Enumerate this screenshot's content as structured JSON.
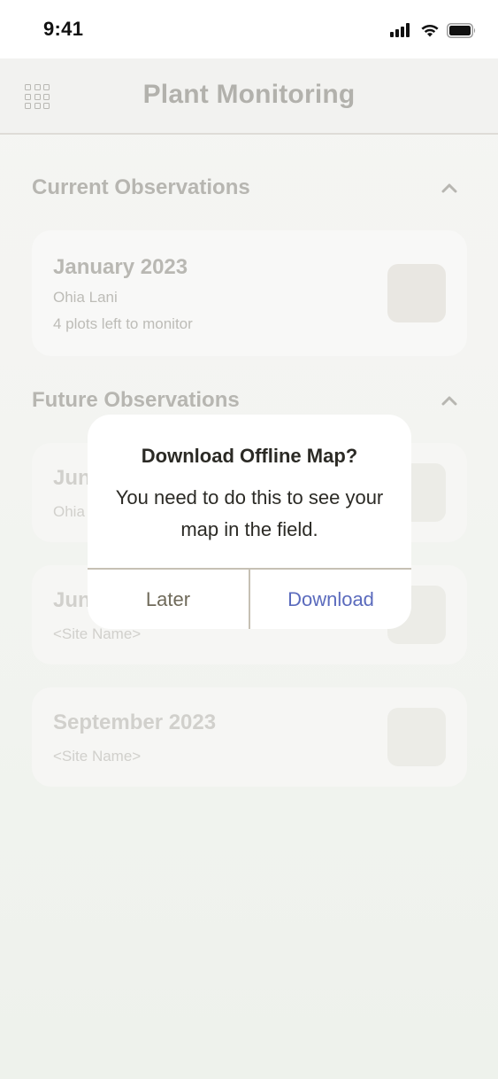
{
  "status_bar": {
    "time": "9:41",
    "icons": [
      "signal-icon",
      "wifi-icon",
      "battery-icon"
    ]
  },
  "header": {
    "title": "Plant Monitoring",
    "menu_icon": "grid-menu-icon"
  },
  "sections": {
    "current": {
      "title": "Current Observations",
      "cards": [
        {
          "title": "January 2023",
          "site": "Ohia Lani",
          "detail": "4 plots left to monitor"
        }
      ]
    },
    "future": {
      "title": "Future Observations",
      "cards": [
        {
          "title": "Jun",
          "site": "Ohia"
        },
        {
          "title": "Jun",
          "site": "<Site Name>"
        },
        {
          "title": "September 2023",
          "site": "<Site Name>"
        }
      ]
    }
  },
  "dialog": {
    "title": "Download Offline Map?",
    "message": "You need to do this to see your map in the field.",
    "cancel_label": "Later",
    "confirm_label": "Download"
  },
  "colors": {
    "accent": "#5b6bbd",
    "dialog_text": "#2b2a25",
    "cancel_text": "#6f6a5a"
  }
}
